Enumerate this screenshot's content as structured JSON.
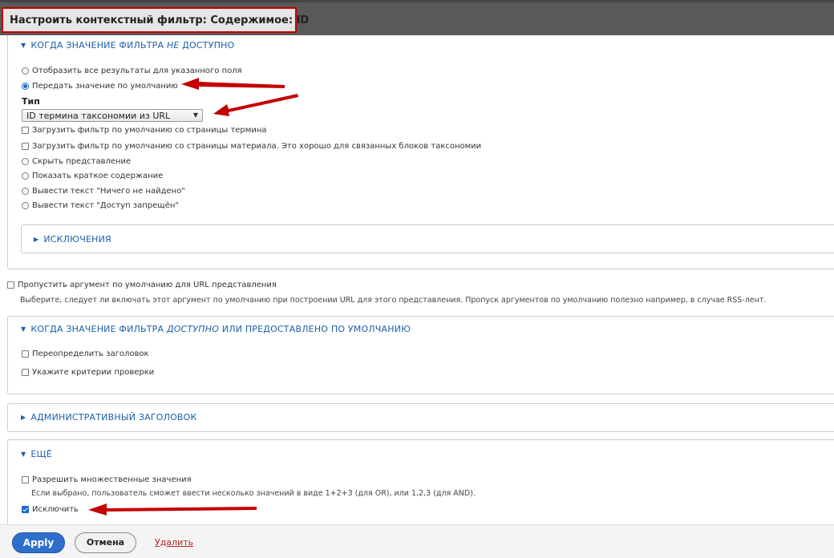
{
  "dialog": {
    "title": "Настроить контекстный фильтр: Содержимое: ID"
  },
  "section_unavailable": {
    "legend_prefix": "КОГДА ЗНАЧЕНИЕ ФИЛЬТРА ",
    "legend_italic": "НЕ",
    "legend_suffix": " ДОСТУПНО",
    "options": [
      {
        "label": "Отобразить все результаты для указанного поля",
        "type": "radio",
        "checked": false
      },
      {
        "label": "Передать значение по умолчанию",
        "type": "radio",
        "checked": true
      }
    ],
    "type_label": "Тип",
    "type_select_value": "ID термина таксономии из URL",
    "checks": [
      {
        "label": "Загрузить фильтр по умолчанию со страницы термина",
        "checked": false
      },
      {
        "label": "Загрузить фильтр по умолчанию со страницы материала. Это хорошо для связанных блоков таксономии",
        "checked": false
      }
    ],
    "more_options": [
      {
        "label": "Скрыть представление",
        "checked": false
      },
      {
        "label": "Показать краткое содержание",
        "checked": false
      },
      {
        "label": "Вывести текст \"Ничего не найдено\"",
        "checked": false
      },
      {
        "label": "Вывести текст \"Доступ запрещён\"",
        "checked": false
      }
    ],
    "exceptions_legend": "ИСКЛЮЧЕНИЯ"
  },
  "skip_default": {
    "label": "Пропустить аргумент по умолчанию для URL представления",
    "checked": false,
    "description": "Выберите, следует ли включать этот аргумент по умолчанию при построении URL для этого представления. Пропуск аргументов по умолчанию полезно например, в случае RSS-лент."
  },
  "section_available": {
    "legend_prefix": "КОГДА ЗНАЧЕНИЕ ФИЛЬТРА ",
    "legend_italic": "ДОСТУПНО",
    "legend_suffix": " ИЛИ ПРЕДОСТАВЛЕНО ПО УМОЛЧАНИЮ",
    "checks": [
      {
        "label": "Переопределить заголовок",
        "checked": false
      },
      {
        "label": "Укажите критерии проверки",
        "checked": false
      }
    ]
  },
  "section_admin": {
    "legend": "АДМИНИСТРАТИВНЫЙ ЗАГОЛОВОК"
  },
  "section_more": {
    "legend": "ЕЩЁ",
    "multiple_label": "Разрешить множественные значения",
    "multiple_checked": false,
    "multiple_desc": "Если выбрано, пользователь сможет ввести несколько значений в виде 1+2+3 (для OR), или 1,2,3 (для AND).",
    "exclude_label": "Исключить",
    "exclude_checked": true
  },
  "footer": {
    "apply": "Apply",
    "cancel": "Отмена",
    "delete": "Удалить"
  },
  "colors": {
    "accent": "#2f6fcc",
    "legend": "#1b5fa8",
    "annotation": "#c40000"
  }
}
